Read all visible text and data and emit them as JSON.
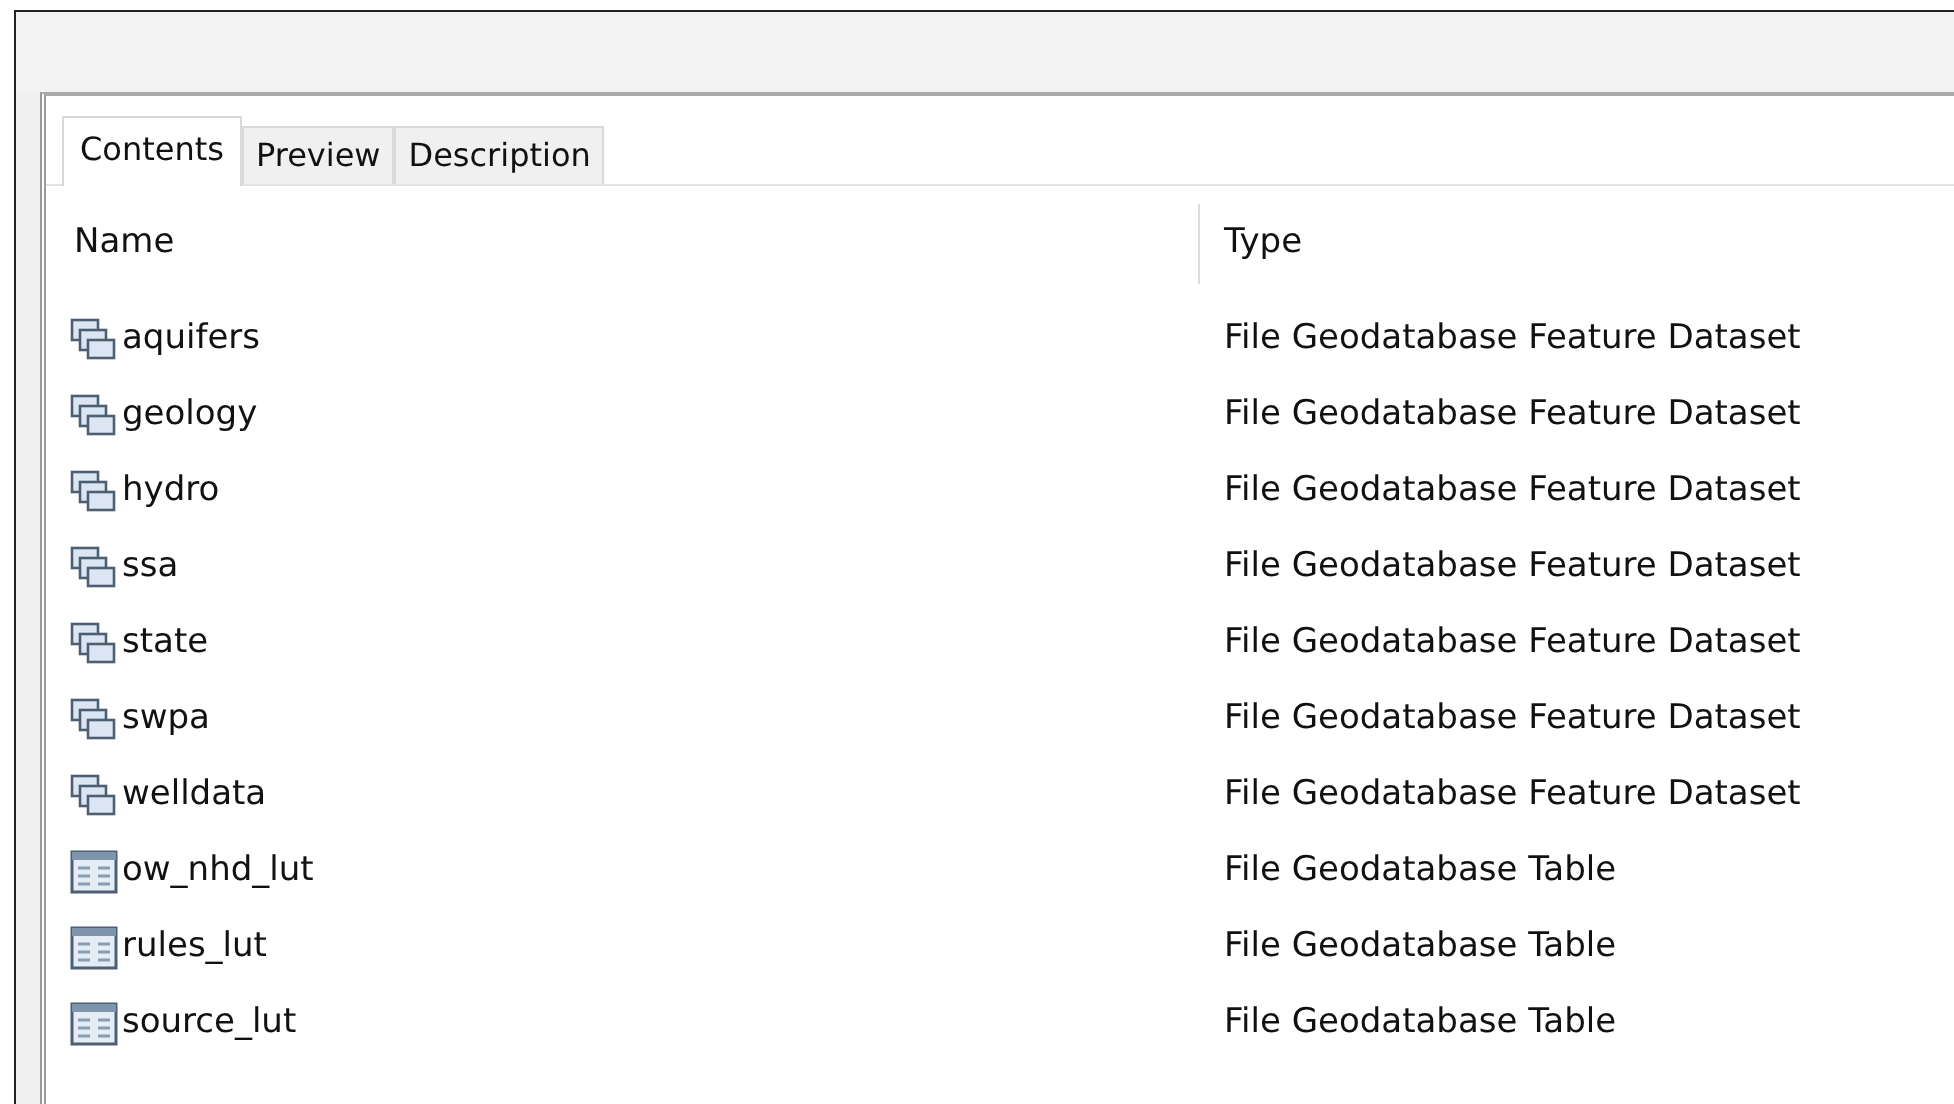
{
  "tabs": [
    {
      "label": "Contents",
      "selected": true
    },
    {
      "label": "Preview",
      "selected": false
    },
    {
      "label": "Description",
      "selected": false
    }
  ],
  "columns": [
    "Name",
    "Type"
  ],
  "rows": [
    {
      "kind": "dataset",
      "name": "aquifers",
      "type": "File Geodatabase Feature Dataset"
    },
    {
      "kind": "dataset",
      "name": "geology",
      "type": "File Geodatabase Feature Dataset"
    },
    {
      "kind": "dataset",
      "name": "hydro",
      "type": "File Geodatabase Feature Dataset"
    },
    {
      "kind": "dataset",
      "name": "ssa",
      "type": "File Geodatabase Feature Dataset"
    },
    {
      "kind": "dataset",
      "name": "state",
      "type": "File Geodatabase Feature Dataset"
    },
    {
      "kind": "dataset",
      "name": "swpa",
      "type": "File Geodatabase Feature Dataset"
    },
    {
      "kind": "dataset",
      "name": "welldata",
      "type": "File Geodatabase Feature Dataset"
    },
    {
      "kind": "table",
      "name": "ow_nhd_lut",
      "type": "File Geodatabase Table"
    },
    {
      "kind": "table",
      "name": "rules_lut",
      "type": "File Geodatabase Table"
    },
    {
      "kind": "table",
      "name": "source_lut",
      "type": "File Geodatabase Table"
    }
  ]
}
